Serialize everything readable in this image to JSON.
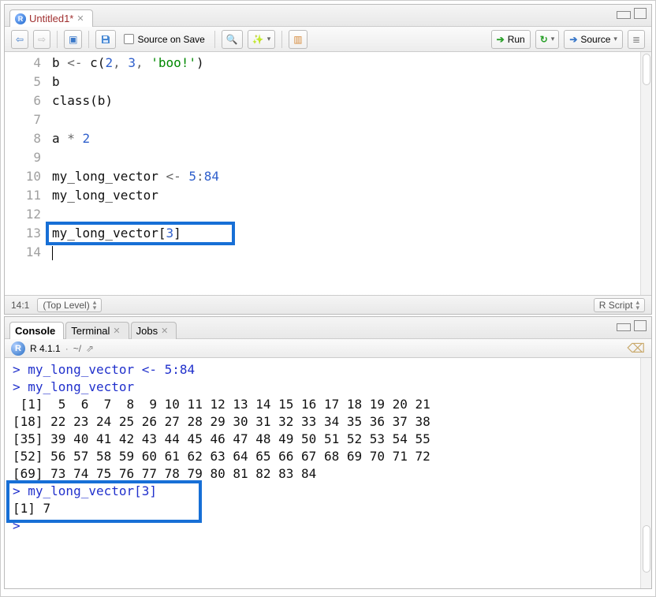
{
  "sourceTab": {
    "title": "Untitled1*"
  },
  "toolbar": {
    "sourceOnSave": "Source on Save",
    "run": "Run",
    "source": "Source"
  },
  "editor": {
    "lines": [
      {
        "n": "4",
        "tokens": [
          [
            "plain",
            "b "
          ],
          [
            "op",
            "<- "
          ],
          [
            "plain",
            "c("
          ],
          [
            "num",
            "2"
          ],
          [
            "pun",
            ", "
          ],
          [
            "num",
            "3"
          ],
          [
            "pun",
            ", "
          ],
          [
            "str",
            "'boo!'"
          ],
          [
            "plain",
            ")"
          ]
        ]
      },
      {
        "n": "5",
        "tokens": [
          [
            "plain",
            "b"
          ]
        ]
      },
      {
        "n": "6",
        "tokens": [
          [
            "plain",
            "class(b)"
          ]
        ]
      },
      {
        "n": "7",
        "tokens": []
      },
      {
        "n": "8",
        "tokens": [
          [
            "plain",
            "a "
          ],
          [
            "op",
            "* "
          ],
          [
            "num",
            "2"
          ]
        ]
      },
      {
        "n": "9",
        "tokens": []
      },
      {
        "n": "10",
        "tokens": [
          [
            "plain",
            "my_long_vector "
          ],
          [
            "op",
            "<- "
          ],
          [
            "num",
            "5"
          ],
          [
            "op",
            ":"
          ],
          [
            "num",
            "84"
          ]
        ]
      },
      {
        "n": "11",
        "tokens": [
          [
            "plain",
            "my_long_vector"
          ]
        ]
      },
      {
        "n": "12",
        "tokens": []
      },
      {
        "n": "13",
        "tokens": [
          [
            "plain",
            "my_long_vector["
          ],
          [
            "num",
            "3"
          ],
          [
            "plain",
            "]"
          ]
        ]
      },
      {
        "n": "14",
        "tokens": []
      }
    ]
  },
  "statusbar": {
    "pos": "14:1",
    "scope": "(Top Level)",
    "lang": "R Script"
  },
  "consoleTabs": {
    "console": "Console",
    "terminal": "Terminal",
    "jobs": "Jobs"
  },
  "consoleHeader": {
    "version": "R 4.1.1",
    "path": "~/"
  },
  "console": {
    "lines": [
      {
        "cls": "in",
        "text": "> my_long_vector <- 5:84"
      },
      {
        "cls": "in",
        "text": "> my_long_vector"
      },
      {
        "cls": "out",
        "text": " [1]  5  6  7  8  9 10 11 12 13 14 15 16 17 18 19 20 21"
      },
      {
        "cls": "out",
        "text": "[18] 22 23 24 25 26 27 28 29 30 31 32 33 34 35 36 37 38"
      },
      {
        "cls": "out",
        "text": "[35] 39 40 41 42 43 44 45 46 47 48 49 50 51 52 53 54 55"
      },
      {
        "cls": "out",
        "text": "[52] 56 57 58 59 60 61 62 63 64 65 66 67 68 69 70 71 72"
      },
      {
        "cls": "out",
        "text": "[69] 73 74 75 76 77 78 79 80 81 82 83 84"
      },
      {
        "cls": "in",
        "text": "> my_long_vector[3]"
      },
      {
        "cls": "out",
        "text": "[1] 7"
      },
      {
        "cls": "in",
        "text": "> "
      }
    ]
  }
}
